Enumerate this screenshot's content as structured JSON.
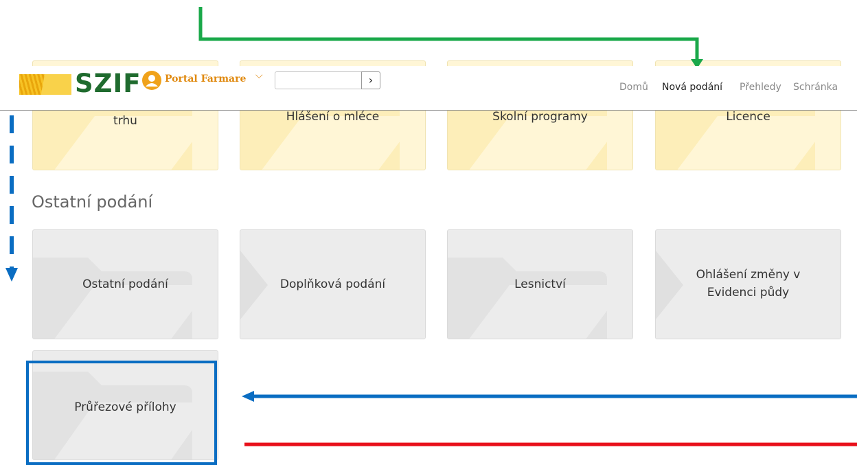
{
  "header": {
    "logo_text": "SZIF",
    "portal_label": "Portal Farmare",
    "search": {
      "value": ""
    },
    "nav": [
      "Domů",
      "Nová podání",
      "Přehledy",
      "Schránka"
    ]
  },
  "tiles_top": [
    {
      "label": "trhu"
    },
    {
      "label": "Hlášení o mléce"
    },
    {
      "label": "Školní programy"
    },
    {
      "label": "Licence"
    }
  ],
  "section": {
    "heading": "Ostatní podání"
  },
  "tiles_other": [
    {
      "label": "Ostatní podání"
    },
    {
      "label": "Doplňková podání"
    },
    {
      "label": "Lesnictví"
    },
    {
      "label_line1": "Ohlášení změny v",
      "label_line2": "Evidenci půdy"
    },
    {
      "label": "Průřezové přílohy"
    }
  ],
  "colors": {
    "brand_green": "#1f6b2e",
    "portal_orange": "#e08a10",
    "tile_yellow": "#fff6d6",
    "tile_grey": "#ececec",
    "annotation_green": "#1aa84a",
    "annotation_blue": "#0a6dc2",
    "annotation_red": "#e8101a"
  }
}
